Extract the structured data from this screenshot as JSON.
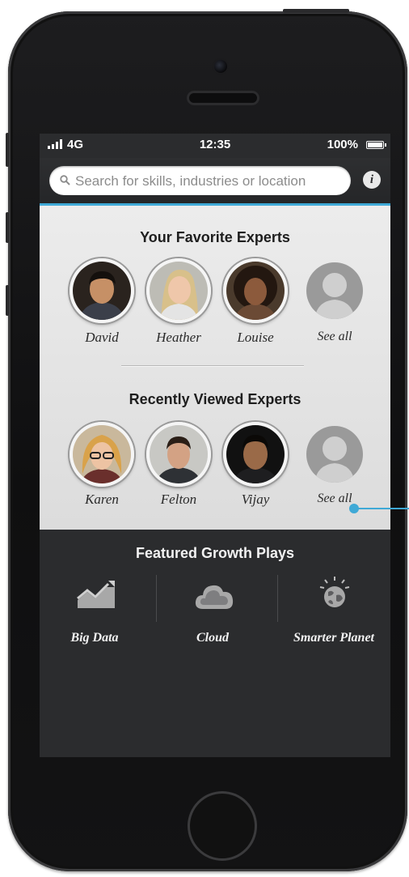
{
  "status_bar": {
    "network": "4G",
    "time": "12:35",
    "battery": "100%"
  },
  "search": {
    "placeholder": "Search for skills, industries or location"
  },
  "info_button": {
    "label": "i"
  },
  "favorite_experts": {
    "title": "Your Favorite Experts",
    "experts": [
      {
        "name": "David"
      },
      {
        "name": "Heather"
      },
      {
        "name": "Louise"
      }
    ],
    "see_all_label": "See all"
  },
  "recent_experts": {
    "title": "Recently Viewed Experts",
    "experts": [
      {
        "name": "Karen"
      },
      {
        "name": "Felton"
      },
      {
        "name": "Vijay"
      }
    ],
    "see_all_label": "See all"
  },
  "growth_plays": {
    "title": "Featured Growth Plays",
    "items": [
      {
        "label": "Big Data",
        "icon": "chart-trend-icon"
      },
      {
        "label": "Cloud",
        "icon": "cloud-icon"
      },
      {
        "label": "Smarter Planet",
        "icon": "globe-icon"
      }
    ]
  },
  "colors": {
    "accent": "#3fa9d6",
    "panel": "#e6e6e6",
    "dark": "#2b2c2e"
  }
}
